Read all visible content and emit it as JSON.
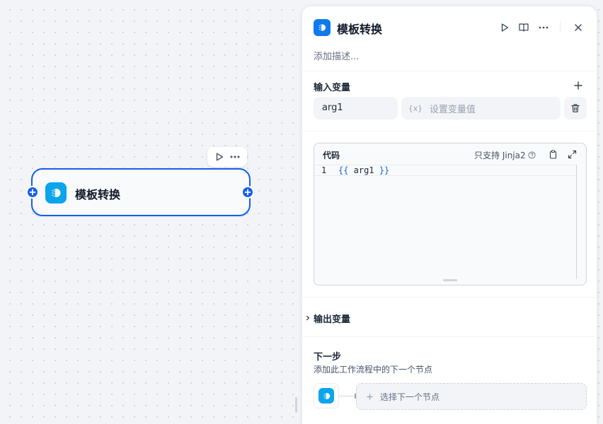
{
  "canvas": {
    "node": {
      "title": "模板转换",
      "icon": "template-transform-icon",
      "accent_color": "#155eef",
      "icon_color": "#0ba5ec"
    },
    "node_toolbar": {
      "run_icon": "play-icon",
      "more_icon": "more-dots-icon"
    }
  },
  "panel": {
    "header": {
      "title": "模板转换",
      "icon": "template-transform-icon",
      "buttons": [
        "play-icon",
        "book-icon",
        "more-dots-icon",
        "close-icon"
      ]
    },
    "description_placeholder": "添加描述...",
    "input_section": {
      "title": "输入变量",
      "variables": [
        {
          "name": "arg1",
          "value_prefix": "{x}",
          "value_placeholder": "设置变量值"
        }
      ]
    },
    "code_section": {
      "title": "代码",
      "hint": "只支持 Jinja2",
      "lines": [
        {
          "number": "1",
          "open": "{{",
          "var": " arg1 ",
          "close": "}}"
        }
      ]
    },
    "output_section": {
      "title": "输出变量"
    },
    "next_step": {
      "title": "下一步",
      "subtitle": "添加此工作流程中的下一个节点",
      "select_label": "选择下一个节点"
    }
  }
}
